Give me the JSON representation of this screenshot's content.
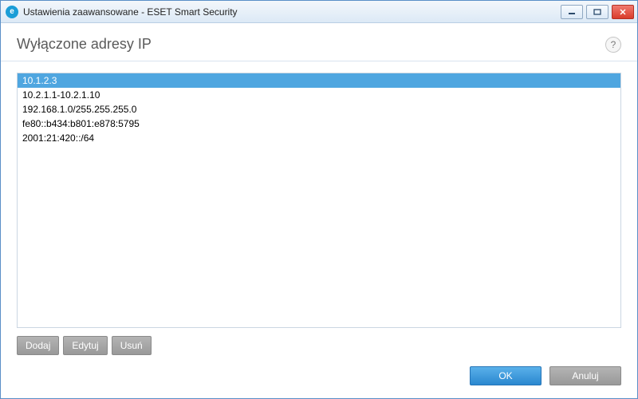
{
  "window": {
    "title": "Ustawienia zaawansowane - ESET Smart Security"
  },
  "header": {
    "title": "Wyłączone adresy IP",
    "help_symbol": "?"
  },
  "list": {
    "items": [
      {
        "value": "10.1.2.3",
        "selected": true
      },
      {
        "value": "10.2.1.1-10.2.1.10",
        "selected": false
      },
      {
        "value": "192.168.1.0/255.255.255.0",
        "selected": false
      },
      {
        "value": "fe80::b434:b801:e878:5795",
        "selected": false
      },
      {
        "value": "2001:21:420::/64",
        "selected": false
      }
    ]
  },
  "buttons": {
    "add": "Dodaj",
    "edit": "Edytuj",
    "delete": "Usuń"
  },
  "footer": {
    "ok": "OK",
    "cancel": "Anuluj"
  },
  "app_icon_letter": "e"
}
